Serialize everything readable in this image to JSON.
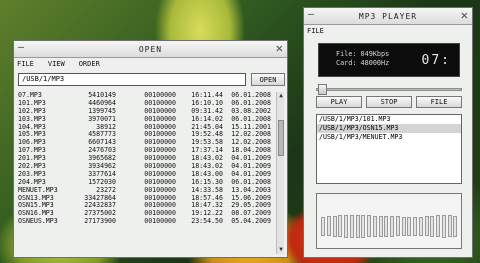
{
  "open_window": {
    "title": "OPEN",
    "menu": [
      "FILE",
      "VIEW",
      "ORDER"
    ],
    "path_value": "/USB/1/MP3",
    "open_button": "OPEN",
    "files": [
      [
        "07.MP3",
        "5410149",
        "00100000",
        "16:11.44",
        "06.01.2008"
      ],
      [
        "101.MP3",
        "4460964",
        "00100000",
        "16:10.10",
        "06.01.2008"
      ],
      [
        "102.MP3",
        "1399745",
        "00100000",
        "09:31.42",
        "03.08.2002"
      ],
      [
        "103.MP3",
        "3970071",
        "00100000",
        "16:14.02",
        "06.01.2008"
      ],
      [
        "104.MP3",
        "38912",
        "00100000",
        "21:45.04",
        "15.11.2001"
      ],
      [
        "105.MP3",
        "4587773",
        "00100000",
        "19:52.48",
        "12.02.2008"
      ],
      [
        "106.MP3",
        "6607143",
        "00100000",
        "19:53.58",
        "12.02.2008"
      ],
      [
        "107.MP3",
        "2476703",
        "00100000",
        "17:37.14",
        "18.04.2008"
      ],
      [
        "201.MP3",
        "3965682",
        "00100000",
        "18:43.02",
        "04.01.2009"
      ],
      [
        "202.MP3",
        "3934962",
        "00100000",
        "18:43.02",
        "04.01.2009"
      ],
      [
        "203.MP3",
        "3377614",
        "00100000",
        "18:43.00",
        "04.01.2009"
      ],
      [
        "204.MP3",
        "1572030",
        "00100000",
        "16:15.30",
        "06.01.2008"
      ],
      [
        "MENUET.MP3",
        "23272",
        "00100000",
        "14:33.58",
        "13.04.2003"
      ],
      [
        "OSN13.MP3",
        "33427864",
        "00100000",
        "18:57.46",
        "15.06.2009"
      ],
      [
        "OSN15.MP3",
        "22432837",
        "00100000",
        "18:47.32",
        "29.05.2009"
      ],
      [
        "OSN16.MP3",
        "27375002",
        "00100000",
        "19:12.22",
        "08.07.2009"
      ],
      [
        "OSNEUS.MP3",
        "27173900",
        "00100000",
        "23:54.50",
        "05.04.2009"
      ]
    ]
  },
  "player_window": {
    "title": "MP3 PLAYER",
    "menu": "FILE",
    "file_info": "File: 049Kbps",
    "card_info": "Card: 48000Hz",
    "time_display": "07:",
    "seek_progress": 0.0,
    "buttons": {
      "play": "PLAY",
      "stop": "STOP",
      "file": "FILE"
    },
    "playlist": [
      "/USB/1/MP3/101.MP3",
      "/USB/1/MP3/OSN15.MP3",
      "/USB/1/MP3/MENUET.MP3"
    ],
    "playlist_selected": 1,
    "eq_levels": [
      0.45,
      0.5,
      0.55,
      0.58,
      0.6,
      0.6,
      0.62,
      0.6,
      0.58,
      0.55,
      0.55,
      0.55,
      0.52,
      0.5,
      0.48,
      0.45,
      0.45,
      0.45,
      0.5,
      0.55,
      0.58,
      0.6,
      0.58,
      0.52
    ]
  }
}
